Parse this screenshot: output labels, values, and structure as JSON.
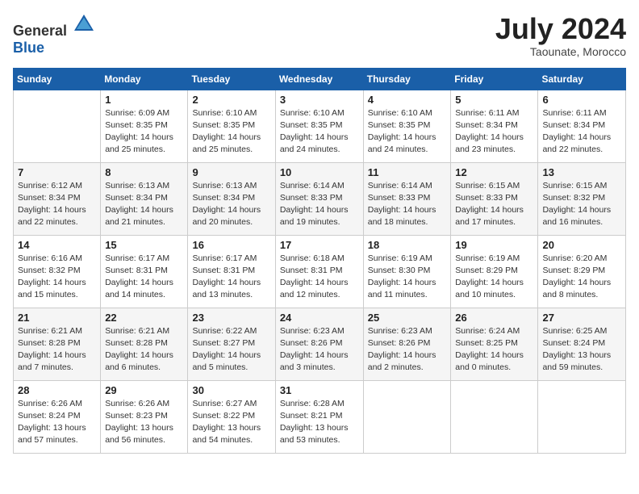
{
  "header": {
    "logo_general": "General",
    "logo_blue": "Blue",
    "month_year": "July 2024",
    "location": "Taounate, Morocco"
  },
  "weekdays": [
    "Sunday",
    "Monday",
    "Tuesday",
    "Wednesday",
    "Thursday",
    "Friday",
    "Saturday"
  ],
  "weeks": [
    [
      {
        "day": "",
        "detail": ""
      },
      {
        "day": "1",
        "detail": "Sunrise: 6:09 AM\nSunset: 8:35 PM\nDaylight: 14 hours\nand 25 minutes."
      },
      {
        "day": "2",
        "detail": "Sunrise: 6:10 AM\nSunset: 8:35 PM\nDaylight: 14 hours\nand 25 minutes."
      },
      {
        "day": "3",
        "detail": "Sunrise: 6:10 AM\nSunset: 8:35 PM\nDaylight: 14 hours\nand 24 minutes."
      },
      {
        "day": "4",
        "detail": "Sunrise: 6:10 AM\nSunset: 8:35 PM\nDaylight: 14 hours\nand 24 minutes."
      },
      {
        "day": "5",
        "detail": "Sunrise: 6:11 AM\nSunset: 8:34 PM\nDaylight: 14 hours\nand 23 minutes."
      },
      {
        "day": "6",
        "detail": "Sunrise: 6:11 AM\nSunset: 8:34 PM\nDaylight: 14 hours\nand 22 minutes."
      }
    ],
    [
      {
        "day": "7",
        "detail": "Sunrise: 6:12 AM\nSunset: 8:34 PM\nDaylight: 14 hours\nand 22 minutes."
      },
      {
        "day": "8",
        "detail": "Sunrise: 6:13 AM\nSunset: 8:34 PM\nDaylight: 14 hours\nand 21 minutes."
      },
      {
        "day": "9",
        "detail": "Sunrise: 6:13 AM\nSunset: 8:34 PM\nDaylight: 14 hours\nand 20 minutes."
      },
      {
        "day": "10",
        "detail": "Sunrise: 6:14 AM\nSunset: 8:33 PM\nDaylight: 14 hours\nand 19 minutes."
      },
      {
        "day": "11",
        "detail": "Sunrise: 6:14 AM\nSunset: 8:33 PM\nDaylight: 14 hours\nand 18 minutes."
      },
      {
        "day": "12",
        "detail": "Sunrise: 6:15 AM\nSunset: 8:33 PM\nDaylight: 14 hours\nand 17 minutes."
      },
      {
        "day": "13",
        "detail": "Sunrise: 6:15 AM\nSunset: 8:32 PM\nDaylight: 14 hours\nand 16 minutes."
      }
    ],
    [
      {
        "day": "14",
        "detail": "Sunrise: 6:16 AM\nSunset: 8:32 PM\nDaylight: 14 hours\nand 15 minutes."
      },
      {
        "day": "15",
        "detail": "Sunrise: 6:17 AM\nSunset: 8:31 PM\nDaylight: 14 hours\nand 14 minutes."
      },
      {
        "day": "16",
        "detail": "Sunrise: 6:17 AM\nSunset: 8:31 PM\nDaylight: 14 hours\nand 13 minutes."
      },
      {
        "day": "17",
        "detail": "Sunrise: 6:18 AM\nSunset: 8:31 PM\nDaylight: 14 hours\nand 12 minutes."
      },
      {
        "day": "18",
        "detail": "Sunrise: 6:19 AM\nSunset: 8:30 PM\nDaylight: 14 hours\nand 11 minutes."
      },
      {
        "day": "19",
        "detail": "Sunrise: 6:19 AM\nSunset: 8:29 PM\nDaylight: 14 hours\nand 10 minutes."
      },
      {
        "day": "20",
        "detail": "Sunrise: 6:20 AM\nSunset: 8:29 PM\nDaylight: 14 hours\nand 8 minutes."
      }
    ],
    [
      {
        "day": "21",
        "detail": "Sunrise: 6:21 AM\nSunset: 8:28 PM\nDaylight: 14 hours\nand 7 minutes."
      },
      {
        "day": "22",
        "detail": "Sunrise: 6:21 AM\nSunset: 8:28 PM\nDaylight: 14 hours\nand 6 minutes."
      },
      {
        "day": "23",
        "detail": "Sunrise: 6:22 AM\nSunset: 8:27 PM\nDaylight: 14 hours\nand 5 minutes."
      },
      {
        "day": "24",
        "detail": "Sunrise: 6:23 AM\nSunset: 8:26 PM\nDaylight: 14 hours\nand 3 minutes."
      },
      {
        "day": "25",
        "detail": "Sunrise: 6:23 AM\nSunset: 8:26 PM\nDaylight: 14 hours\nand 2 minutes."
      },
      {
        "day": "26",
        "detail": "Sunrise: 6:24 AM\nSunset: 8:25 PM\nDaylight: 14 hours\nand 0 minutes."
      },
      {
        "day": "27",
        "detail": "Sunrise: 6:25 AM\nSunset: 8:24 PM\nDaylight: 13 hours\nand 59 minutes."
      }
    ],
    [
      {
        "day": "28",
        "detail": "Sunrise: 6:26 AM\nSunset: 8:24 PM\nDaylight: 13 hours\nand 57 minutes."
      },
      {
        "day": "29",
        "detail": "Sunrise: 6:26 AM\nSunset: 8:23 PM\nDaylight: 13 hours\nand 56 minutes."
      },
      {
        "day": "30",
        "detail": "Sunrise: 6:27 AM\nSunset: 8:22 PM\nDaylight: 13 hours\nand 54 minutes."
      },
      {
        "day": "31",
        "detail": "Sunrise: 6:28 AM\nSunset: 8:21 PM\nDaylight: 13 hours\nand 53 minutes."
      },
      {
        "day": "",
        "detail": ""
      },
      {
        "day": "",
        "detail": ""
      },
      {
        "day": "",
        "detail": ""
      }
    ]
  ]
}
